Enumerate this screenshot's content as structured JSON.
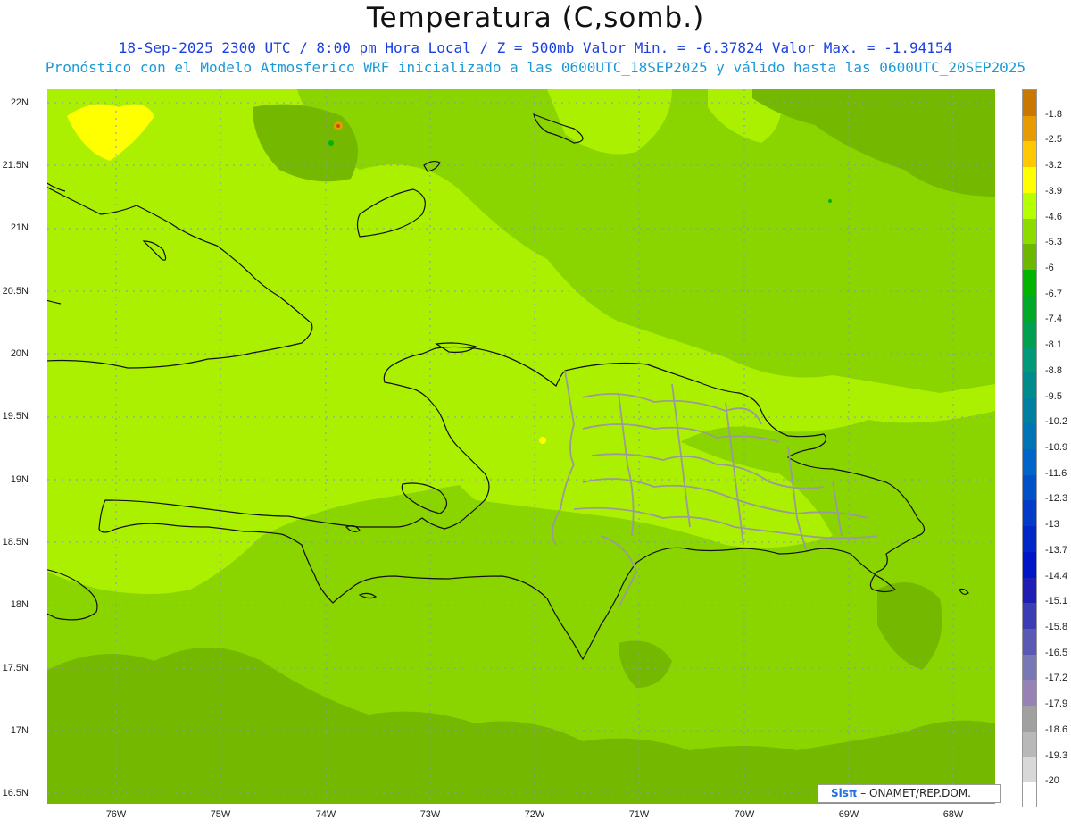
{
  "header": {
    "title": "Temperatura (C,somb.)",
    "line1": "18-Sep-2025  2300 UTC / 8:00 pm Hora Local / Z = 500mb  Valor Min. = -6.37824  Valor Max. = -1.94154",
    "line2": "Pronóstico con el Modelo Atmosferico WRF inicializado a las 0600UTC_18SEP2025 y válido hasta las  0600UTC_20SEP2025"
  },
  "axes": {
    "lat_labels": [
      "22N",
      "21.5N",
      "21N",
      "20.5N",
      "20N",
      "19.5N",
      "19N",
      "18.5N",
      "18N",
      "17.5N",
      "17N",
      "16.5N"
    ],
    "lon_labels": [
      "76W",
      "75W",
      "74W",
      "73W",
      "72W",
      "71W",
      "70W",
      "69W",
      "68W"
    ]
  },
  "legend": {
    "labels": [
      "-1.8",
      "-2.5",
      "-3.2",
      "-3.9",
      "-4.6",
      "-5.3",
      "-6",
      "-6.7",
      "-7.4",
      "-8.1",
      "-8.8",
      "-9.5",
      "-10.2",
      "-10.9",
      "-11.6",
      "-12.3",
      "-13",
      "-13.7",
      "-14.4",
      "-15.1",
      "-15.8",
      "-16.5",
      "-17.2",
      "-17.9",
      "-18.6",
      "-19.3",
      "-20"
    ],
    "colors": [
      "#c87800",
      "#e69b00",
      "#ffc800",
      "#ffff00",
      "#b4ff00",
      "#8cdc00",
      "#6cb800",
      "#00b400",
      "#00aa28",
      "#00a050",
      "#009a78",
      "#008c8c",
      "#0080a0",
      "#0074b4",
      "#0064c8",
      "#0050c8",
      "#003cc8",
      "#0028c8",
      "#0014c8",
      "#1e1eb4",
      "#3c3cb4",
      "#5a5ab4",
      "#7878b4",
      "#9682b4",
      "#a0a0a0",
      "#b8b8b8",
      "#d8d8d8",
      "#ffffff"
    ]
  },
  "credit": {
    "brand": "Sisπ",
    "org": "– ONAMET/REP.DOM."
  },
  "colors": {
    "base": "#8ad400",
    "warm": "#aaf000",
    "cool": "#74b800"
  }
}
